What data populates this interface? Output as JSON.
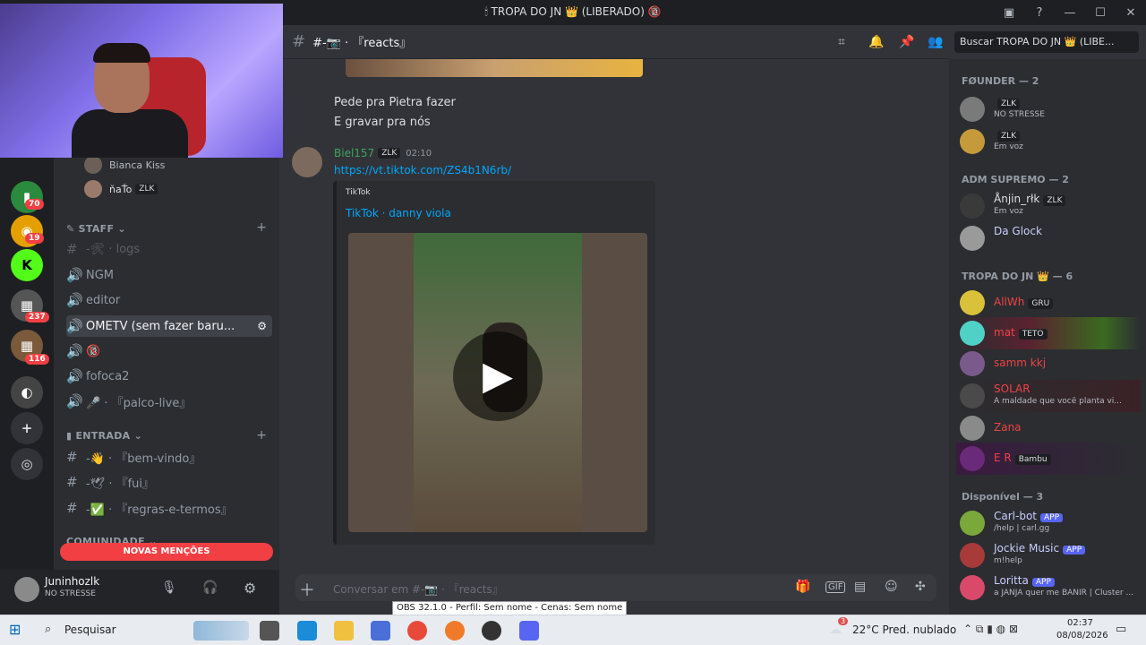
{
  "window": {
    "title": "🕯 TROPA DO JN 👑 (LIBERADO) 🔞"
  },
  "header": {
    "channel": "#-📷 · 『reacts』",
    "search_placeholder": "Buscar TROPA DO JN 👑 (LIBE..."
  },
  "server_badges": [
    "70",
    "19",
    "237",
    "116"
  ],
  "channels_sidebar": {
    "voice_users": [
      {
        "name": "Bianca Kiss"
      },
      {
        "name": "ňaŤo",
        "tag": "ZLK"
      }
    ],
    "staff_category": "STAFF",
    "channels": [
      {
        "name": "-🛠 · logs"
      },
      {
        "name": "NGM"
      },
      {
        "name": "editor"
      },
      {
        "name": "OMETV (sem fazer baru..."
      },
      {
        "name": "🔞"
      },
      {
        "name": "fofoca2"
      },
      {
        "name": "🎤 · 『palco-live』"
      }
    ],
    "entrada_category": "ENTRADA",
    "entrada_channels": [
      {
        "name": "-👋 · 『bem-vindo』"
      },
      {
        "name": "-🕊 · 『fui』"
      },
      {
        "name": "-✅ · 『regras-e-termos』"
      }
    ],
    "comunidade_category": "COMUNIDADE",
    "mentions_label": "NOVAS MENÇÕES"
  },
  "user_panel": {
    "username": "Juninhozlk",
    "status": "NO STRESSE"
  },
  "messages": {
    "prev_lines": [
      "Pede pra Pietra fazer",
      "E gravar pra nós"
    ],
    "author": "Biel157",
    "author_tag": "ZLK",
    "time": "02:10",
    "link": "https://vt.tiktok.com/ZS4b1N6rb/",
    "embed_provider": "TikTok",
    "embed_title": "TikTok · danny viola"
  },
  "composer": {
    "placeholder": "Conversar em #-📷 · 『reacts』"
  },
  "members": {
    "groups": [
      {
        "label": "FØUNDER — 2",
        "members": [
          {
            "name": "",
            "tag": "ZLK",
            "status": "NO STRESSE",
            "color": "#dbdee1"
          },
          {
            "name": "",
            "tag": "ZLK",
            "status": "Em voz",
            "color": "#dbdee1"
          }
        ]
      },
      {
        "label": "ADM SUPREMO — 2",
        "members": [
          {
            "name": "Ånjin_rłk",
            "tag": "ZLK",
            "status": "Em voz",
            "color": "#dbdee1"
          },
          {
            "name": "Da Glock",
            "tag": "",
            "status": "",
            "color": "#c9cdfb"
          }
        ]
      },
      {
        "label": "TROPA DO JN 👑 — 6",
        "members": [
          {
            "name": "AllWh",
            "tag": "GRU",
            "status": "",
            "color": "#ed4245"
          },
          {
            "name": "mat",
            "tag": "TETO",
            "status": "",
            "color": "#ed4245"
          },
          {
            "name": "samm kkj",
            "tag": "",
            "status": "",
            "color": "#ed4245"
          },
          {
            "name": "SOLAR",
            "tag": "",
            "status": "A maldade que você planta vi...",
            "color": "#ed4245"
          },
          {
            "name": "Zana",
            "tag": "",
            "status": "",
            "color": "#ed4245"
          },
          {
            "name": "E R",
            "tag": "Bambu",
            "status": "",
            "color": "#ed4245"
          }
        ]
      },
      {
        "label": "Disponível — 3",
        "members": [
          {
            "name": "Carl-bot",
            "tag": "APP",
            "status": "/help | carl.gg",
            "color": "#c9cdfb"
          },
          {
            "name": "Jockie Music",
            "tag": "APP",
            "status": "m!help",
            "color": "#c9cdfb"
          },
          {
            "name": "Loritta",
            "tag": "APP",
            "status": "a JANJA quer me BANIR | Cluster ...",
            "color": "#c9cdfb"
          }
        ]
      }
    ]
  },
  "obs_tooltip": "OBS 32.1.0 - Perfil: Sem nome - Cenas: Sem nome",
  "taskbar": {
    "search_label": "Pesquisar",
    "weather": "22°C  Pred. nublado",
    "weather_badge": "3",
    "time": "02:37",
    "date": "08/08/2026"
  }
}
